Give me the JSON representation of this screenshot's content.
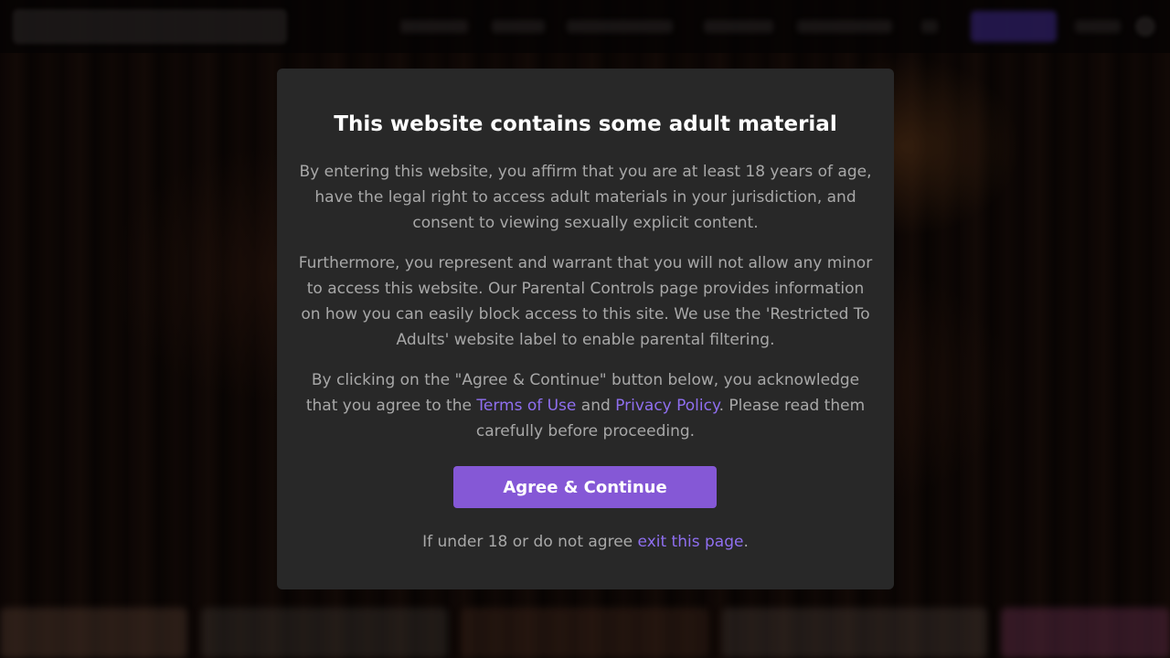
{
  "modal": {
    "title": "This website contains some adult material",
    "paragraph1": "By entering this website, you affirm that you are at least 18 years of age, have the legal right to access adult materials in your jurisdiction, and consent to viewing sexually explicit content.",
    "paragraph2": "Furthermore, you represent and warrant that you will not allow any minor to access this website. Our Parental Controls page provides information on how you can easily block access to this site. We use the 'Restricted To Adults' website label to enable parental filtering.",
    "paragraph3": {
      "text_before": "By clicking on the \"Agree & Continue\" button below, you acknowledge that you agree to the ",
      "terms_link": "Terms of Use",
      "text_middle": " and ",
      "privacy_link": "Privacy Policy",
      "text_after": ". Please read them carefully before proceeding."
    },
    "agree_button": "Agree & Continue",
    "exit_line": {
      "text_before": "If under 18 or do not agree ",
      "exit_link": "exit this page",
      "text_after": "."
    }
  },
  "colors": {
    "modal_background": "#282828",
    "accent": "#8558d6",
    "link": "#8f6ff0",
    "title_text": "#ffffff",
    "body_text": "#a8a8a8"
  }
}
